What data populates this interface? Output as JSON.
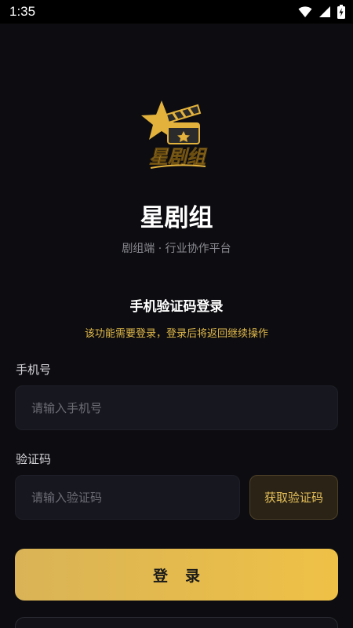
{
  "status_bar": {
    "time": "1:35",
    "icons": [
      "wifi-icon",
      "signal-icon",
      "battery-charging-icon"
    ]
  },
  "brand": {
    "logo_text": "星剧组",
    "title": "星剧组",
    "subtitle": "剧组端 · 行业协作平台"
  },
  "login": {
    "title": "手机验证码登录",
    "tip": "该功能需要登录，登录后将返回继续操作",
    "phone_label": "手机号",
    "phone_placeholder": "请输入手机号",
    "phone_value": "",
    "code_label": "验证码",
    "code_placeholder": "请输入验证码",
    "code_value": "",
    "get_code_label": "获取验证码",
    "submit_label": "登录"
  },
  "colors": {
    "background": "#0d0d11",
    "accent": "#e6c05a",
    "button_gradient_start": "#d9b356",
    "button_gradient_end": "#efc146",
    "input_bg": "#17171f"
  }
}
